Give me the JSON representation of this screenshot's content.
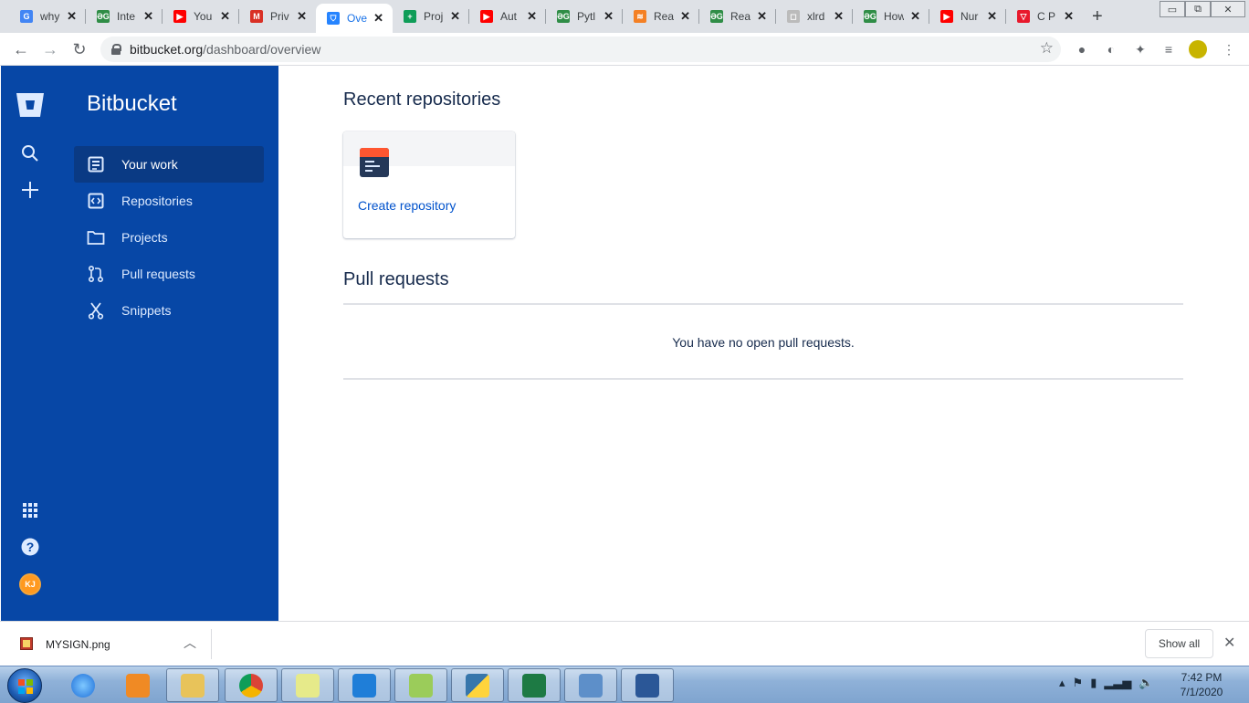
{
  "browser": {
    "tabs": [
      {
        "label": "why",
        "fav_color": "#4285f4",
        "fav_text": "G"
      },
      {
        "label": "Inte",
        "fav_color": "#2f8d46",
        "fav_text": "ƏG"
      },
      {
        "label": "You",
        "fav_color": "#ff0000",
        "fav_text": "▶"
      },
      {
        "label": "Priv",
        "fav_color": "#d93025",
        "fav_text": "M"
      },
      {
        "label": "Ove",
        "fav_color": "#2684ff",
        "fav_text": "⛉"
      },
      {
        "label": "Proj",
        "fav_color": "#0f9d58",
        "fav_text": "+"
      },
      {
        "label": "Aut",
        "fav_color": "#ff0000",
        "fav_text": "▶"
      },
      {
        "label": "Pytl",
        "fav_color": "#2f8d46",
        "fav_text": "ƏG"
      },
      {
        "label": "Rea",
        "fav_color": "#f48024",
        "fav_text": "≋"
      },
      {
        "label": "Rea",
        "fav_color": "#2f8d46",
        "fav_text": "ƏG"
      },
      {
        "label": "xlrd",
        "fav_color": "#bbbbbb",
        "fav_text": "◻"
      },
      {
        "label": "How",
        "fav_color": "#2f8d46",
        "fav_text": "ƏG"
      },
      {
        "label": "Nur",
        "fav_color": "#ff0000",
        "fav_text": "▶"
      },
      {
        "label": "C P",
        "fav_color": "#e8192c",
        "fav_text": "▽"
      }
    ],
    "active_tab_index": 4,
    "url_host": "bitbucket.org",
    "url_path": "/dashboard/overview"
  },
  "bitbucket": {
    "brand": "Bitbucket",
    "avatar_initials": "KJ",
    "nav": [
      {
        "label": "Your work",
        "icon": "your-work-icon"
      },
      {
        "label": "Repositories",
        "icon": "repositories-icon"
      },
      {
        "label": "Projects",
        "icon": "projects-icon"
      },
      {
        "label": "Pull requests",
        "icon": "pull-requests-icon"
      },
      {
        "label": "Snippets",
        "icon": "snippets-icon"
      }
    ]
  },
  "main": {
    "recent_title": "Recent repositories",
    "create_repo_label": "Create repository",
    "pr_title": "Pull requests",
    "pr_empty": "You have no open pull requests."
  },
  "downloads": {
    "file_name": "MYSIGN.png",
    "show_all_label": "Show all"
  },
  "taskbar": {
    "time": "7:42 PM",
    "date": "7/1/2020"
  },
  "colors": {
    "sidebar_bg": "#0747a6",
    "link": "#0052cc",
    "heading": "#172b4d"
  }
}
